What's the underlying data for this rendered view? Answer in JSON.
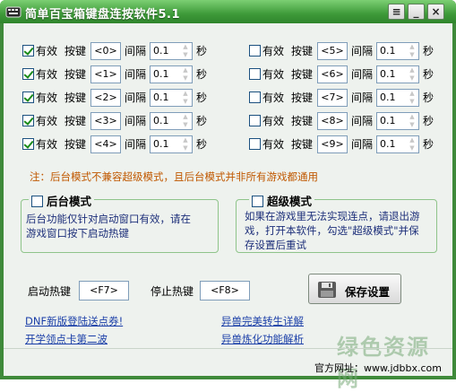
{
  "window": {
    "title": "简单百宝箱键盘连按软件5.1",
    "buttons": {
      "menu": "≡",
      "minimize": "_",
      "close": "×"
    }
  },
  "keys_left": [
    {
      "checked": true,
      "enabled_label": "有效",
      "key_label": "按键",
      "key": "<0>",
      "interval_label": "间隔",
      "interval": "0.1",
      "unit": "秒"
    },
    {
      "checked": true,
      "enabled_label": "有效",
      "key_label": "按键",
      "key": "<1>",
      "interval_label": "间隔",
      "interval": "0.1",
      "unit": "秒"
    },
    {
      "checked": true,
      "enabled_label": "有效",
      "key_label": "按键",
      "key": "<2>",
      "interval_label": "间隔",
      "interval": "0.1",
      "unit": "秒"
    },
    {
      "checked": true,
      "enabled_label": "有效",
      "key_label": "按键",
      "key": "<3>",
      "interval_label": "间隔",
      "interval": "0.1",
      "unit": "秒"
    },
    {
      "checked": true,
      "enabled_label": "有效",
      "key_label": "按键",
      "key": "<4>",
      "interval_label": "间隔",
      "interval": "0.1",
      "unit": "秒"
    }
  ],
  "keys_right": [
    {
      "checked": false,
      "enabled_label": "有效",
      "key_label": "按键",
      "key": "<5>",
      "interval_label": "间隔",
      "interval": "0.1",
      "unit": "秒"
    },
    {
      "checked": false,
      "enabled_label": "有效",
      "key_label": "按键",
      "key": "<6>",
      "interval_label": "间隔",
      "interval": "0.1",
      "unit": "秒"
    },
    {
      "checked": false,
      "enabled_label": "有效",
      "key_label": "按键",
      "key": "<7>",
      "interval_label": "间隔",
      "interval": "0.1",
      "unit": "秒"
    },
    {
      "checked": false,
      "enabled_label": "有效",
      "key_label": "按键",
      "key": "<8>",
      "interval_label": "间隔",
      "interval": "0.1",
      "unit": "秒"
    },
    {
      "checked": false,
      "enabled_label": "有效",
      "key_label": "按键",
      "key": "<9>",
      "interval_label": "间隔",
      "interval": "0.1",
      "unit": "秒"
    }
  ],
  "note": "注：后台模式不兼容超级模式，且后台模式并非所有游戏都通用",
  "background_mode": {
    "title": "后台模式",
    "checked": false,
    "desc_line1": "后台功能仅针对启动窗口有效，请在",
    "desc_line2": "游戏窗口按下启动热键"
  },
  "super_mode": {
    "title": "超级模式",
    "checked": false,
    "desc_line1": "如果在游戏里无法实现连点，请退出游",
    "desc_line2": "戏，打开本软件，勾选\"超级模式\"并保",
    "desc_line3": "存设置后重试"
  },
  "hotkeys": {
    "start_label": "启动热键",
    "start_value": "<F7>",
    "stop_label": "停止热键",
    "stop_value": "<F8>"
  },
  "save_button": {
    "label": "保存设置"
  },
  "links": {
    "dnf": "DNF新版登陆送点券!",
    "kaixue": "开学领点卡第二波",
    "yishou1": "异兽完美转生详解",
    "yishou2": "异兽炼化功能解析"
  },
  "footer": {
    "label": "官方网址：",
    "url": "www.jdbbx.com"
  },
  "watermark": "绿色资源网",
  "colors": {
    "title_bar": "#3e9a39",
    "client_bg": "#eef2ee",
    "note": "#c05800",
    "desc_text": "#1d2f7a",
    "link": "#1b3fa8"
  }
}
